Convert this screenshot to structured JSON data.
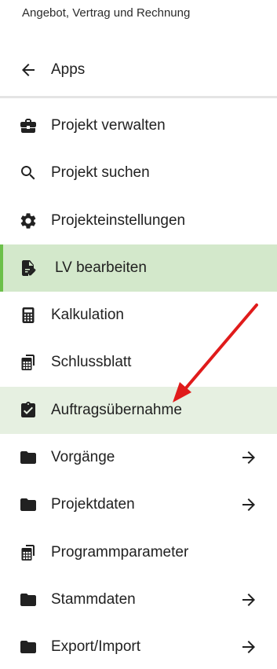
{
  "header": {
    "title": "Angebot, Vertrag und Rechnung"
  },
  "back": {
    "label": "Apps",
    "icon": "arrow-left-icon"
  },
  "menu": {
    "items": [
      {
        "label": "Projekt verwalten",
        "icon": "briefcase-icon"
      },
      {
        "label": "Projekt suchen",
        "icon": "search-icon"
      },
      {
        "label": "Projekteinstellungen",
        "icon": "gear-icon"
      },
      {
        "label": "LV bearbeiten",
        "icon": "document-edit-icon",
        "state": "selected"
      },
      {
        "label": "Kalkulation",
        "icon": "calculator-icon"
      },
      {
        "label": "Schlussblatt",
        "icon": "spreadsheet-copy-icon"
      },
      {
        "label": "Auftragsübernahme",
        "icon": "clipboard-check-icon",
        "state": "highlighted"
      },
      {
        "label": "Vorgänge",
        "icon": "folder-icon",
        "submenu": true
      },
      {
        "label": "Projektdaten",
        "icon": "folder-icon",
        "submenu": true
      },
      {
        "label": "Programmparameter",
        "icon": "spreadsheet-copy-icon"
      },
      {
        "label": "Stammdaten",
        "icon": "folder-icon",
        "submenu": true
      },
      {
        "label": "Export/Import",
        "icon": "folder-icon",
        "submenu": true
      }
    ]
  },
  "colors": {
    "selected_bg": "#d3e8cb",
    "selected_accent": "#6cc04a",
    "highlight_bg": "#e6f0e1",
    "annotation_arrow": "#e01b1b"
  }
}
